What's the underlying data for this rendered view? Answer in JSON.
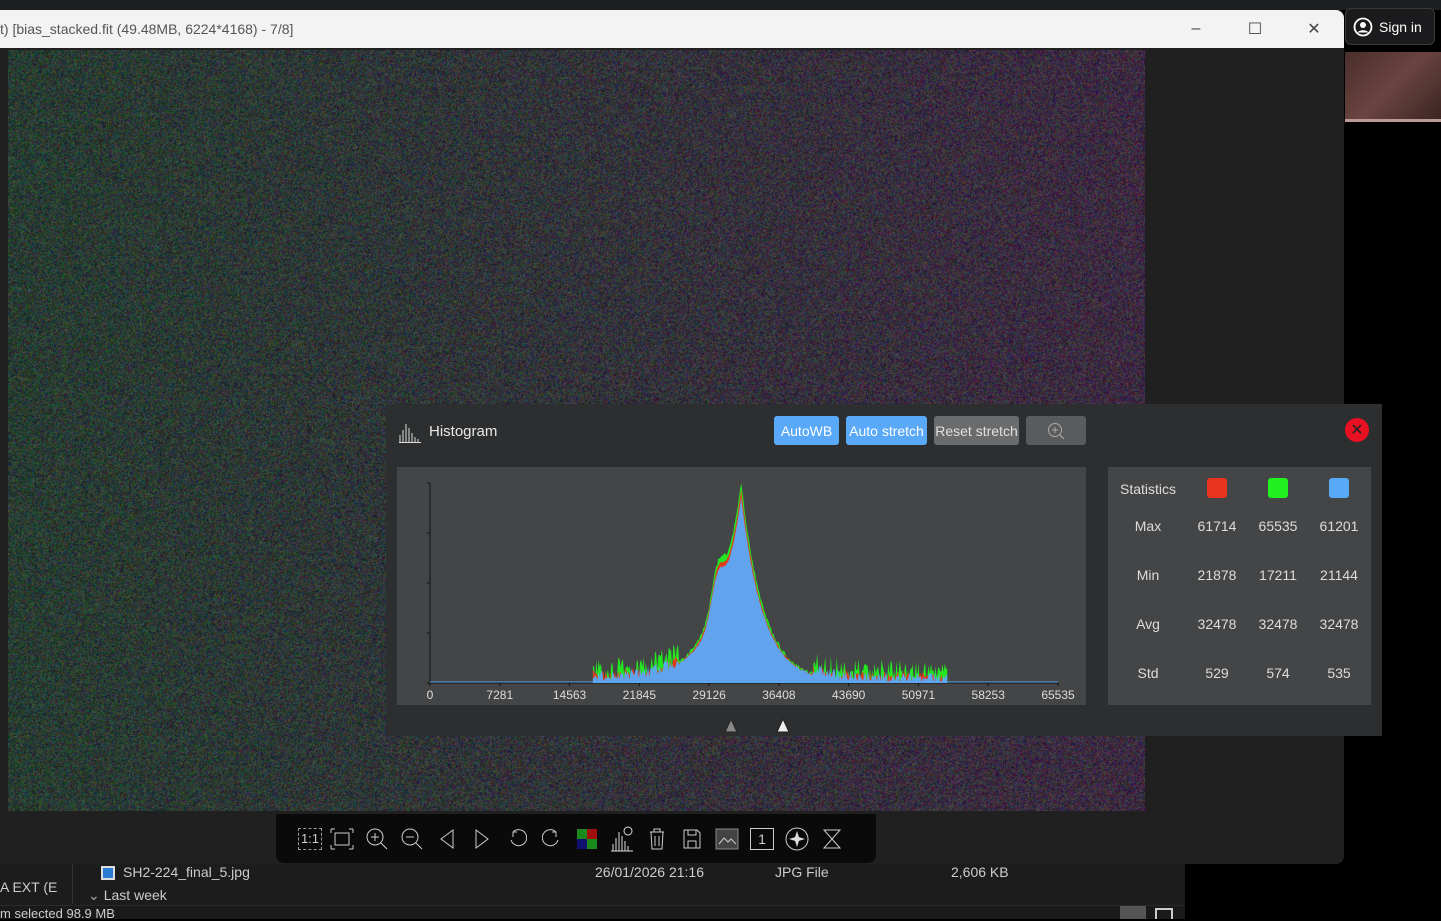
{
  "window": {
    "title": "t) [bias_stacked.fit (49.48MB, 6224*4168) - 7/8]",
    "minimize": "–",
    "maximize": "☐",
    "close": "✕"
  },
  "signin": {
    "label": "Sign in"
  },
  "histogram": {
    "title": "Histogram",
    "buttons": {
      "autowb": "AutoWB",
      "auto_stretch": "Auto stretch",
      "reset_stretch": "Reset stretch"
    },
    "close": "✕",
    "x_ticks": [
      "0",
      "7281",
      "14563",
      "21845",
      "29126",
      "36408",
      "43690",
      "50971",
      "58253",
      "65535"
    ],
    "channel_colors": {
      "red": "#e8341c",
      "green": "#22f020",
      "blue": "#5aa9f8"
    },
    "black_point_fraction": 0.466,
    "white_point_fraction": 0.55
  },
  "chart_data": {
    "type": "area",
    "title": "Histogram",
    "xlim": [
      0,
      65535
    ],
    "x_ticks": [
      0,
      7281,
      14563,
      21845,
      29126,
      36408,
      43690,
      50971,
      58253,
      65535
    ],
    "peak_x": 32478,
    "series": [
      {
        "name": "Red",
        "min": 21878,
        "max": 61714
      },
      {
        "name": "Green",
        "min": 17211,
        "max": 65535
      },
      {
        "name": "Blue",
        "min": 21144,
        "max": 61201
      }
    ]
  },
  "statistics": {
    "header": "Statistics",
    "rows": [
      {
        "label": "Max",
        "r": "61714",
        "g": "65535",
        "b": "61201"
      },
      {
        "label": "Min",
        "r": "21878",
        "g": "17211",
        "b": "21144"
      },
      {
        "label": "Avg",
        "r": "32478",
        "g": "32478",
        "b": "32478"
      },
      {
        "label": "Std",
        "r": "529",
        "g": "574",
        "b": "535"
      }
    ]
  },
  "toolbar": {
    "one_to_one": "1:1",
    "one_label": "1"
  },
  "explorer": {
    "drive": "A EXT (E",
    "file_name": "SH2-224_final_5.jpg",
    "date": "26/01/2026 21:16",
    "type": "JPG File",
    "size": "2,606 KB",
    "group": "Last week",
    "status": "m selected  98.9 MB"
  }
}
